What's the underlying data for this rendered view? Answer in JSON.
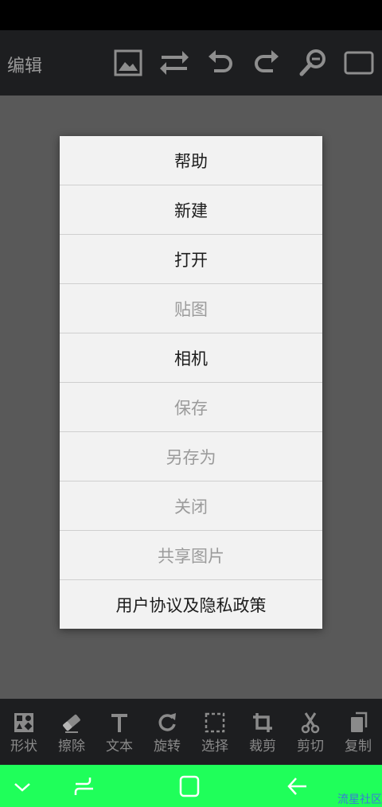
{
  "header": {
    "title": "编辑"
  },
  "toolbar_icons": [
    "image-icon",
    "swap-icon",
    "undo-icon",
    "redo-icon",
    "zoom-icon",
    "fullscreen-icon"
  ],
  "menu": {
    "items": [
      {
        "label": "帮助",
        "enabled": true
      },
      {
        "label": "新建",
        "enabled": true
      },
      {
        "label": "打开",
        "enabled": true
      },
      {
        "label": "贴图",
        "enabled": false
      },
      {
        "label": "相机",
        "enabled": true
      },
      {
        "label": "保存",
        "enabled": false
      },
      {
        "label": "另存为",
        "enabled": false
      },
      {
        "label": "关闭",
        "enabled": false
      },
      {
        "label": "共享图片",
        "enabled": false
      },
      {
        "label": "用户协议及隐私政策",
        "enabled": true
      }
    ]
  },
  "bottom_tools": [
    {
      "label": "形状",
      "icon": "shapes-icon"
    },
    {
      "label": "擦除",
      "icon": "eraser-icon"
    },
    {
      "label": "文本",
      "icon": "text-icon"
    },
    {
      "label": "旋转",
      "icon": "rotate-icon"
    },
    {
      "label": "选择",
      "icon": "select-icon"
    },
    {
      "label": "裁剪",
      "icon": "crop-icon"
    },
    {
      "label": "剪切",
      "icon": "scissors-icon"
    },
    {
      "label": "复制",
      "icon": "copy-icon"
    }
  ],
  "nav_icons": [
    "collapse-icon",
    "recent-apps-icon",
    "home-icon",
    "back-icon"
  ],
  "watermark": "流星社区",
  "colors": {
    "toolbar_bg": "#1d1e20",
    "canvas_bg": "#595959",
    "menu_bg": "#f2f2f2",
    "enabled_text": "#1c1c1c",
    "disabled_text": "#9b9b9b",
    "nav_bar_bg": "#1fff5a"
  }
}
